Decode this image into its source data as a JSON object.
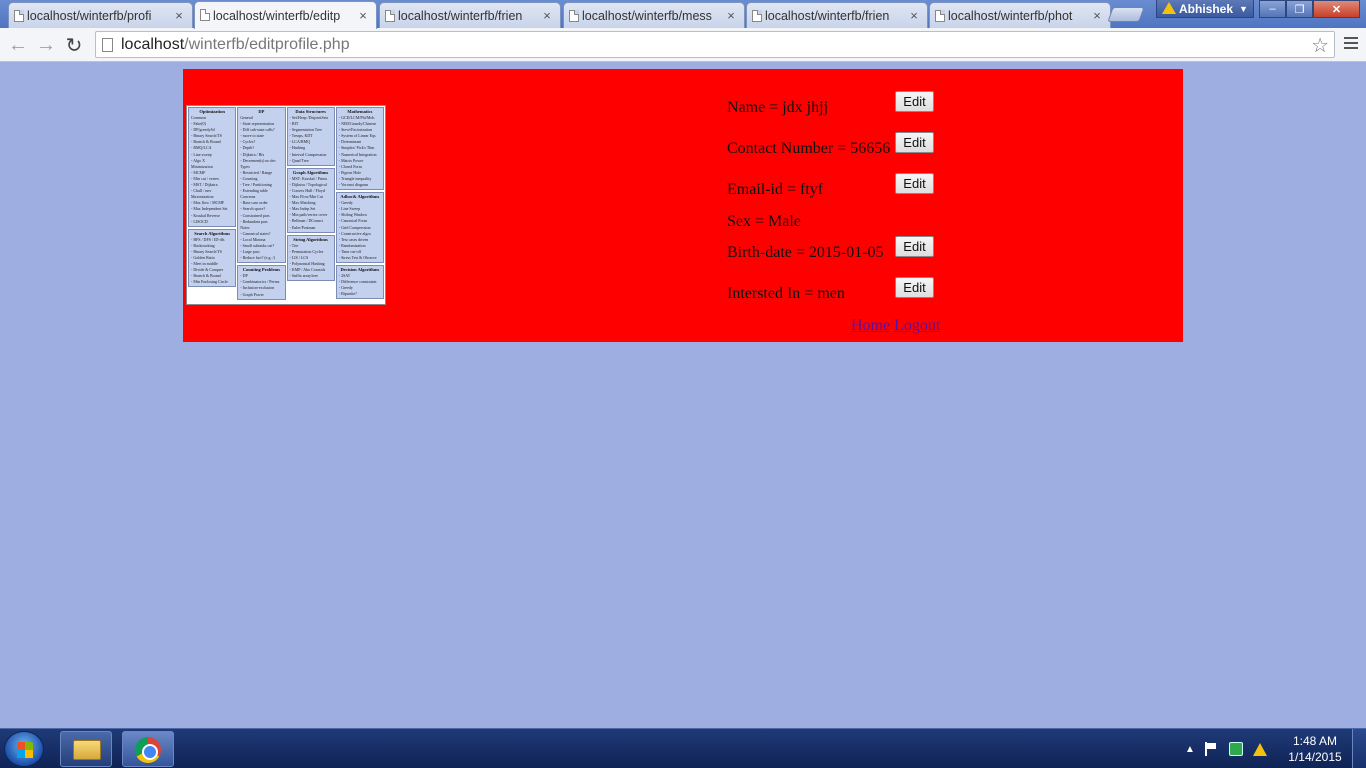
{
  "browser": {
    "tabs": [
      {
        "label": "localhost/winterfb/profi",
        "active": false
      },
      {
        "label": "localhost/winterfb/editp",
        "active": true
      },
      {
        "label": "localhost/winterfb/frien",
        "active": false
      },
      {
        "label": "localhost/winterfb/mess",
        "active": false
      },
      {
        "label": "localhost/winterfb/frien",
        "active": false
      },
      {
        "label": "localhost/winterfb/phot",
        "active": false
      }
    ],
    "close_glyph": "×",
    "user_name": "Abhishek",
    "url_host": "localhost",
    "url_path": "/winterfb/editprofile.php"
  },
  "profile": {
    "name": "Name = jdx jhjj",
    "contact": "Contact Number = 56656",
    "email": "Email-id = ftyf",
    "sex": "Sex = Male",
    "birthdate": "Birth-date = 2015-01-05",
    "interested": "Intersted In = men",
    "edit_label": "Edit"
  },
  "links": {
    "home": "Home",
    "logout": "Logout"
  },
  "cheatsheet": {
    "columns": [
      [
        {
          "title": "Optimization",
          "lines": [
            "Common",
            "- Fake(0)",
            "- DP/greedy/bf",
            "- Binary Search/TS",
            "- Branch & Bound",
            "- RMQ/LCA",
            "- Line sweep",
            "- Algo X",
            "Minimization",
            "- MCMF",
            "- Min cut / vertex",
            "- MST / Dijkstra",
            "- Chull / nnv",
            "Maximization",
            "- Max flow / MCMF",
            "- Max Independent Set",
            "- Kruskal Reverse",
            "- LISOCD"
          ]
        },
        {
          "title": "Search Algorithms",
          "lines": [
            "- BFS / DFS / ID-dfs",
            "- Backtracking",
            "- Binary Search/TS",
            "- Golden Ratio",
            "- Meet in middle",
            "- Divide & Conquer",
            "- Branch & Bound",
            "- Min Enclosing Circle"
          ]
        }
      ],
      [
        {
          "title": "DP",
          "lines": [
            "General",
            "- State representation",
            "- Diff sub-state calls?",
            "- move to state",
            "- Cycles?",
            "- Depth?",
            "- Dijkstra / Bfs",
            "- Decrement(s) no dec",
            "Types",
            "- Restricted / Range",
            "- Counting",
            "- Tree / Partitioning",
            "- Extending table",
            "Concerns",
            "- Base case order",
            "- Search space?",
            "- Constrained pars",
            "- Redundant pars",
            "Notes",
            "- Canonical states?",
            "- Local Minima",
            "- Small subtasks cut?",
            "- Large pars",
            "- Reduce fact? (e.g. /)"
          ]
        },
        {
          "title": "Counting Problems",
          "lines": [
            "- DP",
            "- Combinatorics / Perms",
            "- Inclusion-exclusion",
            "- Graph Power"
          ]
        }
      ],
      [
        {
          "title": "Data Structures",
          "lines": [
            "- Set/Heap /DisjointSets",
            "- BIT",
            "- Segmentation Tree",
            "- Treaps, KDT",
            "- LCA/RMQ",
            "- Hashing",
            "- Interval Compression",
            "- Quad Tree"
          ]
        },
        {
          "title": "Graph Algorithms",
          "lines": [
            "- MST: Kruskal / Prims",
            "- Dijkstra / Topological",
            "- Convex Hull / Floyd",
            "- Max Flow/Min Cut",
            "- Max Matching",
            "- Max Indep Set",
            "- Min path/vertex cover",
            "- Bellman / DConnct",
            "- Euler/Postman"
          ]
        },
        {
          "title": "String Algorithms",
          "lines": [
            "- Trie",
            "- Permutation Cycles",
            "- LIS / LCS",
            "- Polynomial Hashing",
            "- KMP / Aho Corasick",
            "- Suffix array/tree"
          ]
        }
      ],
      [
        {
          "title": "Mathematics",
          "lines": [
            "- GCD/LCM/Phi/Mob",
            "- NIM/Grundy/Chinese",
            "- Sieve/Factorization",
            "- System of Linear Eqs",
            "- Determinant",
            "- Simplex/ Pick's Thm",
            "- Numerical Integration",
            "- Matrix Power",
            "- Closed Form",
            "- Pigeon Hole",
            "- Triangle inequality",
            "- Voronoi diagram"
          ]
        },
        {
          "title": "Adhoc& Algorithms",
          "lines": [
            "- Greedy",
            "- Line Sweep",
            "- Sliding Window",
            "- Canonical Form",
            "- Grid Compression",
            "- Constructive algos",
            "- Test cases driven",
            "- Randomization",
            "- Time cut-off",
            "- Stress Test & Observe"
          ]
        },
        {
          "title": "Decision Algorithms",
          "lines": [
            "- 2SAT",
            "- Difference constraints",
            "- Greedy",
            "- Bipartite?"
          ]
        }
      ]
    ]
  },
  "taskbar": {
    "clock_time": "1:48 AM",
    "clock_date": "1/14/2015"
  }
}
